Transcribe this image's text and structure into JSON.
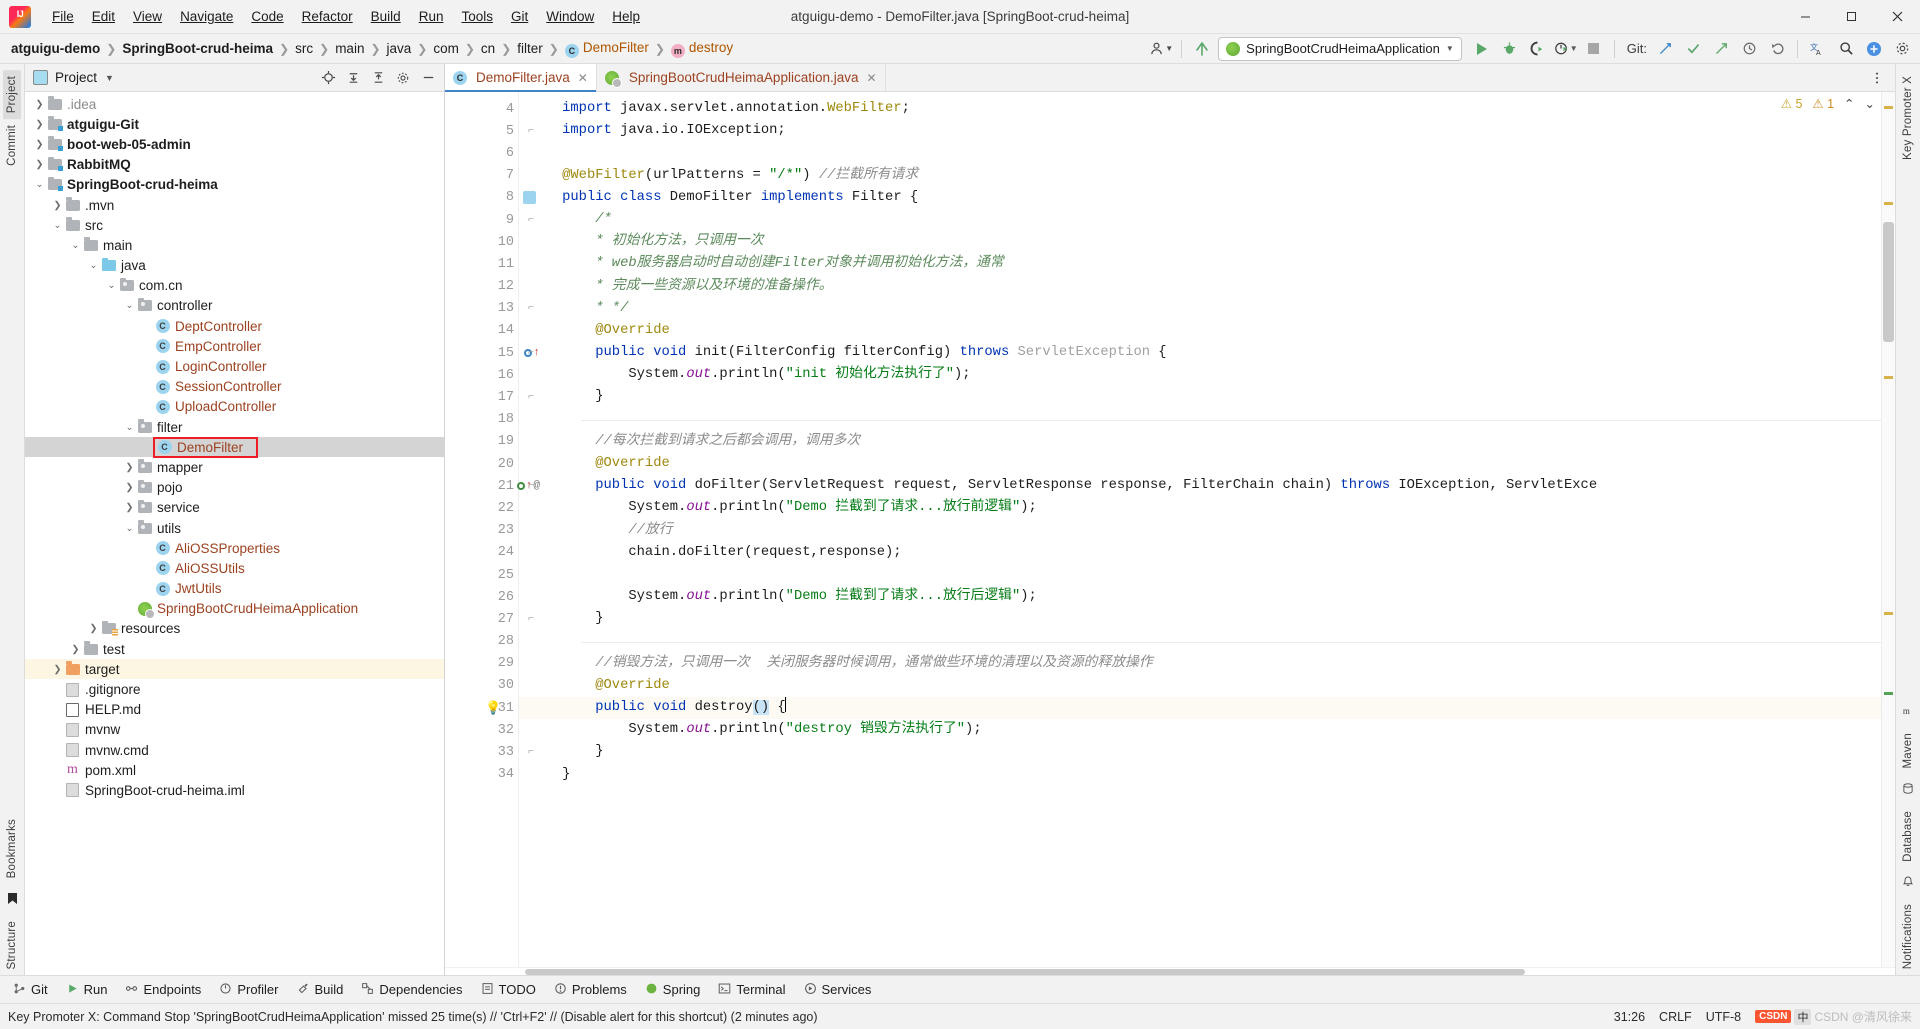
{
  "window": {
    "title": "atguigu-demo - DemoFilter.java [SpringBoot-crud-heima]",
    "minimize": "—",
    "maximize": "▢",
    "close": "✕"
  },
  "menu": [
    {
      "label": "File"
    },
    {
      "label": "Edit"
    },
    {
      "label": "View"
    },
    {
      "label": "Navigate"
    },
    {
      "label": "Code"
    },
    {
      "label": "Refactor"
    },
    {
      "label": "Build"
    },
    {
      "label": "Run"
    },
    {
      "label": "Tools"
    },
    {
      "label": "Git"
    },
    {
      "label": "Window"
    },
    {
      "label": "Help"
    }
  ],
  "breadcrumb": [
    {
      "label": "atguigu-demo",
      "style": "bold"
    },
    {
      "label": "SpringBoot-crud-heima",
      "style": "bold"
    },
    {
      "label": "src",
      "style": "plain"
    },
    {
      "label": "main",
      "style": "plain"
    },
    {
      "label": "java",
      "style": "plain"
    },
    {
      "label": "com",
      "style": "plain"
    },
    {
      "label": "cn",
      "style": "plain"
    },
    {
      "label": "filter",
      "style": "plain"
    },
    {
      "label": "DemoFilter",
      "style": "class"
    },
    {
      "label": "destroy",
      "style": "method"
    }
  ],
  "toolbar": {
    "run_config": "SpringBootCrudHeimaApplication",
    "run_config_caret": "▼",
    "git_label": "Git:",
    "search_icon": "search-icon",
    "run_icon": "run-icon",
    "debug_icon": "debug-icon",
    "coverage_icon": "run-with-coverage-icon",
    "profiler_icon": "profiler-icon",
    "stop_icon": "stop-icon",
    "updates_icon": "update-project-icon",
    "commit_icon": "commit-icon",
    "push_icon": "push-icon",
    "history_icon": "history-icon",
    "rollback_icon": "rollback-icon",
    "translate_icon": "translate-icon",
    "account_icon": "account-icon",
    "settings_icon": "settings-icon"
  },
  "left_strip": {
    "tabs": [
      "Project",
      "Commit"
    ],
    "bottom_tabs": [
      "Bookmarks",
      "Structure"
    ]
  },
  "right_strip": {
    "tabs": [
      "Key Promoter X",
      "Maven",
      "Database",
      "Notifications"
    ]
  },
  "project_panel": {
    "title": "Project",
    "caret": "▼",
    "actions": [
      "locate-icon",
      "expand-all-icon",
      "collapse-all-icon",
      "settings-icon",
      "hide-icon"
    ],
    "tree": [
      {
        "label": ".idea",
        "depth": 1,
        "arrow": "right",
        "icon": "folder",
        "style": "gray"
      },
      {
        "label": "atguigu-Git",
        "depth": 1,
        "arrow": "right",
        "icon": "folder-module",
        "style": "bold"
      },
      {
        "label": "boot-web-05-admin",
        "depth": 1,
        "arrow": "right",
        "icon": "folder-module",
        "style": "bold"
      },
      {
        "label": "RabbitMQ",
        "depth": 1,
        "arrow": "right",
        "icon": "folder-module",
        "style": "bold"
      },
      {
        "label": "SpringBoot-crud-heima",
        "depth": 1,
        "arrow": "down",
        "icon": "folder-module",
        "style": "bold"
      },
      {
        "label": ".mvn",
        "depth": 2,
        "arrow": "right",
        "icon": "folder",
        "style": "plain"
      },
      {
        "label": "src",
        "depth": 2,
        "arrow": "down",
        "icon": "folder",
        "style": "plain"
      },
      {
        "label": "main",
        "depth": 3,
        "arrow": "down",
        "icon": "folder",
        "style": "plain"
      },
      {
        "label": "java",
        "depth": 4,
        "arrow": "down",
        "icon": "folder-source",
        "style": "plain"
      },
      {
        "label": "com.cn",
        "depth": 5,
        "arrow": "down",
        "icon": "folder-package",
        "style": "plain"
      },
      {
        "label": "controller",
        "depth": 6,
        "arrow": "down",
        "icon": "folder-package",
        "style": "plain"
      },
      {
        "label": "DeptController",
        "depth": 7,
        "arrow": "none",
        "icon": "class",
        "style": "brown"
      },
      {
        "label": "EmpController",
        "depth": 7,
        "arrow": "none",
        "icon": "class",
        "style": "brown"
      },
      {
        "label": "LoginController",
        "depth": 7,
        "arrow": "none",
        "icon": "class",
        "style": "brown"
      },
      {
        "label": "SessionController",
        "depth": 7,
        "arrow": "none",
        "icon": "class",
        "style": "brown"
      },
      {
        "label": "UploadController",
        "depth": 7,
        "arrow": "none",
        "icon": "class",
        "style": "brown"
      },
      {
        "label": "filter",
        "depth": 6,
        "arrow": "down",
        "icon": "folder-package",
        "style": "plain"
      },
      {
        "label": "DemoFilter",
        "depth": 7,
        "arrow": "none",
        "icon": "class",
        "style": "brown",
        "selected": true,
        "highlighted": true
      },
      {
        "label": "mapper",
        "depth": 6,
        "arrow": "right",
        "icon": "folder-package",
        "style": "plain"
      },
      {
        "label": "pojo",
        "depth": 6,
        "arrow": "right",
        "icon": "folder-package",
        "style": "plain"
      },
      {
        "label": "service",
        "depth": 6,
        "arrow": "right",
        "icon": "folder-package",
        "style": "plain"
      },
      {
        "label": "utils",
        "depth": 6,
        "arrow": "down",
        "icon": "folder-package",
        "style": "plain"
      },
      {
        "label": "AliOSSProperties",
        "depth": 7,
        "arrow": "none",
        "icon": "class",
        "style": "brown"
      },
      {
        "label": "AliOSSUtils",
        "depth": 7,
        "arrow": "none",
        "icon": "class",
        "style": "brown"
      },
      {
        "label": "JwtUtils",
        "depth": 7,
        "arrow": "none",
        "icon": "class",
        "style": "brown"
      },
      {
        "label": "SpringBootCrudHeimaApplication",
        "depth": 6,
        "arrow": "none",
        "icon": "spring-class",
        "style": "brown"
      },
      {
        "label": "resources",
        "depth": 4,
        "arrow": "right",
        "icon": "folder-resource",
        "style": "plain"
      },
      {
        "label": "test",
        "depth": 3,
        "arrow": "right",
        "icon": "folder",
        "style": "plain"
      },
      {
        "label": "target",
        "depth": 2,
        "arrow": "right",
        "icon": "folder-excluded",
        "style": "plain",
        "row_highlight": true
      },
      {
        "label": ".gitignore",
        "depth": 2,
        "arrow": "none",
        "icon": "file-git",
        "style": "plain"
      },
      {
        "label": "HELP.md",
        "depth": 2,
        "arrow": "none",
        "icon": "file-md",
        "style": "plain"
      },
      {
        "label": "mvnw",
        "depth": 2,
        "arrow": "none",
        "icon": "file",
        "style": "plain"
      },
      {
        "label": "mvnw.cmd",
        "depth": 2,
        "arrow": "none",
        "icon": "file",
        "style": "plain"
      },
      {
        "label": "pom.xml",
        "depth": 2,
        "arrow": "none",
        "icon": "file-maven",
        "style": "plain"
      },
      {
        "label": "SpringBoot-crud-heima.iml",
        "depth": 2,
        "arrow": "none",
        "icon": "file-iml",
        "style": "plain"
      }
    ]
  },
  "editor": {
    "tabs": [
      {
        "label": "DemoFilter.java",
        "icon": "class-icon",
        "active": true,
        "close": "✕"
      },
      {
        "label": "SpringBootCrudHeimaApplication.java",
        "icon": "spring-class-icon",
        "active": false,
        "close": "✕"
      }
    ],
    "inspections": {
      "warnings": "5",
      "weak_warnings": "1",
      "up": "⌃",
      "down": "⌄"
    },
    "first_line_number": 4,
    "lines": [
      {
        "n": 4,
        "html": "    <span class='kw'>import</span> javax.servlet.annotation.<span class='ann'>WebFilter</span>;"
      },
      {
        "n": 5,
        "html": "    <span class='kw'>import</span> java.io.IOException;"
      },
      {
        "n": 6,
        "html": ""
      },
      {
        "n": 7,
        "html": "    <span class='ann'>@WebFilter</span>(urlPatterns = <span class='str'>\"/*\"</span>) <span class='cmt'>//拦截所有请求</span>"
      },
      {
        "n": 8,
        "html": "    <span class='kw'>public class</span> DemoFilter <span class='kw'>implements</span> Filter {"
      },
      {
        "n": 9,
        "html": "        <span class='jdoc'>/*</span>"
      },
      {
        "n": 10,
        "html": "        <span class='jdoc'>* 初始化方法，只调用一次</span>"
      },
      {
        "n": 11,
        "html": "        <span class='jdoc'>* web服务器启动时自动创建Filter对象并调用初始化方法，通常</span>"
      },
      {
        "n": 12,
        "html": "        <span class='jdoc'>* 完成一些资源以及环境的准备操作。</span>"
      },
      {
        "n": 13,
        "html": "        <span class='jdoc'>* */</span>"
      },
      {
        "n": 14,
        "html": "        <span class='ann'>@Override</span>"
      },
      {
        "n": 15,
        "html": "        <span class='kw'>public void</span> init(FilterConfig filterConfig) <span class='kw'>throws</span> <span class='gray'>ServletException</span> {"
      },
      {
        "n": 16,
        "html": "            System.<span class='fld'>out</span>.println(<span class='str'>\"init 初始化方法执行了\"</span>);"
      },
      {
        "n": 17,
        "html": "        }"
      },
      {
        "n": 18,
        "html": ""
      },
      {
        "n": 19,
        "html": "        <span class='cmt'>//每次拦截到请求之后都会调用，调用多次</span>"
      },
      {
        "n": 20,
        "html": "        <span class='ann'>@Override</span>"
      },
      {
        "n": 21,
        "html": "        <span class='kw'>public void</span> doFilter(ServletRequest request, ServletResponse response, FilterChain chain) <span class='kw'>throws</span> IOException, ServletExce"
      },
      {
        "n": 22,
        "html": "            System.<span class='fld'>out</span>.println(<span class='str'>\"Demo 拦截到了请求...放行前逻辑\"</span>);"
      },
      {
        "n": 23,
        "html": "            <span class='cmt'>//放行</span>"
      },
      {
        "n": 24,
        "html": "            chain.doFilter(request,response);"
      },
      {
        "n": 25,
        "html": ""
      },
      {
        "n": 26,
        "html": "            System.<span class='fld'>out</span>.println(<span class='str'>\"Demo 拦截到了请求...放行后逻辑\"</span>);"
      },
      {
        "n": 27,
        "html": "        }"
      },
      {
        "n": 28,
        "html": ""
      },
      {
        "n": 29,
        "html": "        <span class='cmt'>//销毁方法，只调用一次  关闭服务器时候调用，通常做些环境的清理以及资源的释放操作</span>"
      },
      {
        "n": 30,
        "html": "        <span class='ann'>@Override</span>"
      },
      {
        "n": 31,
        "html": "        <span class='kw'>public void</span> destroy<span class='sel-tok'>()</span> {",
        "current": true
      },
      {
        "n": 32,
        "html": "            System.<span class='fld'>out</span>.println(<span class='str'>\"destroy 销毁方法执行了\"</span>);"
      },
      {
        "n": 33,
        "html": "        }"
      },
      {
        "n": 34,
        "html": "    }"
      }
    ]
  },
  "bottom_tabs": [
    {
      "label": "Git",
      "icon": "git-icon"
    },
    {
      "label": "Run",
      "icon": "run-icon"
    },
    {
      "label": "Endpoints",
      "icon": "endpoints-icon"
    },
    {
      "label": "Profiler",
      "icon": "profiler-icon"
    },
    {
      "label": "Build",
      "icon": "build-icon"
    },
    {
      "label": "Dependencies",
      "icon": "dependencies-icon"
    },
    {
      "label": "TODO",
      "icon": "todo-icon"
    },
    {
      "label": "Problems",
      "icon": "problems-icon"
    },
    {
      "label": "Spring",
      "icon": "spring-icon"
    },
    {
      "label": "Terminal",
      "icon": "terminal-icon"
    },
    {
      "label": "Services",
      "icon": "services-icon"
    }
  ],
  "statusbar": {
    "message": "Key Promoter X: Command Stop 'SpringBootCrudHeimaApplication' missed 25 time(s) // 'Ctrl+F2' // (Disable alert for this shortcut) (2 minutes ago)",
    "caret_position": "31:26",
    "line_separator": "CRLF",
    "encoding": "UTF-8",
    "watermark": "CSDN @清风徐来",
    "csdn_label": "CSDN",
    "ime": "中"
  },
  "colors": {
    "accent_blue": "#4083c9",
    "keyword_blue": "#0033b3",
    "string_green": "#067d17",
    "comment_gray": "#8c8c8c",
    "annotation_gold": "#9e880d",
    "highlight_red": "#ee1c25",
    "class_brown": "#9c4221",
    "selection_gray": "#d4d4d4"
  }
}
